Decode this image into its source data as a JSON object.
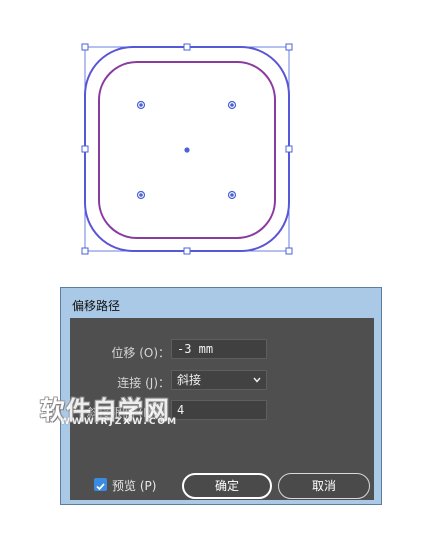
{
  "artwork": {
    "outer_path_color": "#5b54d4",
    "inner_path_color": "#8b3a9e",
    "selection_color": "#4a63d8"
  },
  "dialog": {
    "title": "偏移路径",
    "offset": {
      "label": "位移 (O)：",
      "value": "-3 mm"
    },
    "joins": {
      "label": "连接 (J)：",
      "value": "斜接"
    },
    "miter_limit": {
      "label": "斜接限制 (M)：",
      "value": "4"
    },
    "preview": {
      "label": "预览 (P)",
      "checked": true
    },
    "ok_label": "确定",
    "cancel_label": "取消"
  },
  "watermark": {
    "text": "软件自学网",
    "subtext": "WWW.RJZXW.COM"
  }
}
